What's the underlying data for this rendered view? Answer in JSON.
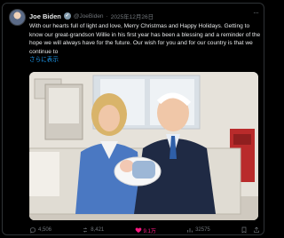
{
  "post": {
    "author_name": "Joe Biden",
    "handle": "@JoeBiden",
    "separator": "·",
    "date": "2025年12月26日",
    "text": "With our hearts full of light and love, Merry Christmas and Happy Holidays. Getting to know our great-grandson Willie in his first year has been a blessing and a reminder of the hope we will always have for the future. Our wish for you and for our country is that we continue to",
    "show_more": "さらに表示",
    "photo_icon": "photo-of-family-with-baby"
  },
  "actions": {
    "reply_count": "4,506",
    "repost_count": "8,421",
    "like_count": "9.1万",
    "views_count": "32575",
    "like_color": "#f91880"
  },
  "icons": {
    "verified": "verified-badge-icon",
    "more": "more-icon",
    "reply": "reply-icon",
    "repost": "repost-icon",
    "like": "heart-icon",
    "views": "views-icon",
    "bookmark": "bookmark-icon",
    "share": "share-icon"
  }
}
